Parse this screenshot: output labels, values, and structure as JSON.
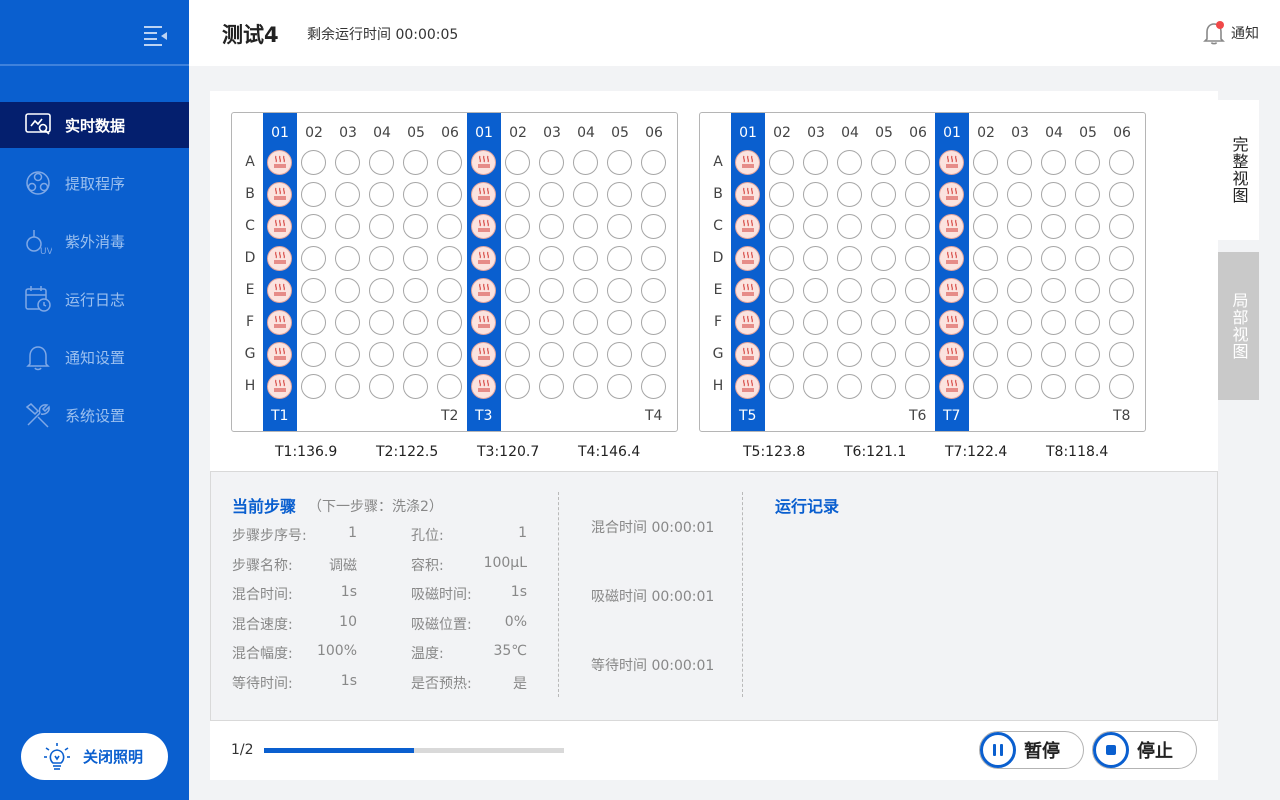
{
  "sidebar": {
    "items": [
      {
        "label": "实时数据",
        "icon": "monitor-data-icon",
        "active": true
      },
      {
        "label": "提取程序",
        "icon": "molecule-icon",
        "active": false
      },
      {
        "label": "紫外消毒",
        "icon": "uv-lamp-icon",
        "active": false
      },
      {
        "label": "运行日志",
        "icon": "calendar-clock-icon",
        "active": false
      },
      {
        "label": "通知设置",
        "icon": "bell-icon",
        "active": false
      },
      {
        "label": "系统设置",
        "icon": "tools-icon",
        "active": false
      }
    ],
    "light_button": "关闭照明"
  },
  "header": {
    "title": "测试4",
    "remaining": "剩余运行时间 00:00:05",
    "notify": "通知"
  },
  "colors": {
    "primary": "#0a5fcf",
    "active_nav": "#041f6e",
    "heated_well": "#fbe3df",
    "badge": "#f04848"
  },
  "plates": [
    {
      "columns": [
        "01",
        "02",
        "03",
        "04",
        "05",
        "06",
        "01",
        "02",
        "03",
        "04",
        "05",
        "06"
      ],
      "highlight_cols": [
        0,
        6
      ],
      "rows": [
        "A",
        "B",
        "C",
        "D",
        "E",
        "F",
        "G",
        "H"
      ],
      "labels": [
        "T1",
        "T2",
        "T3",
        "T4"
      ],
      "temps": [
        "T1:136.9",
        "T2:122.5",
        "T3:120.7",
        "T4:146.4"
      ]
    },
    {
      "columns": [
        "01",
        "02",
        "03",
        "04",
        "05",
        "06",
        "01",
        "02",
        "03",
        "04",
        "05",
        "06"
      ],
      "highlight_cols": [
        0,
        6
      ],
      "rows": [
        "A",
        "B",
        "C",
        "D",
        "E",
        "F",
        "G",
        "H"
      ],
      "labels": [
        "T5",
        "T6",
        "T7",
        "T8"
      ],
      "temps": [
        "T5:123.8",
        "T6:121.1",
        "T7:122.4",
        "T8:118.4"
      ]
    }
  ],
  "view_tabs": {
    "full": "完整视图",
    "partial": "局部视图"
  },
  "current_step": {
    "title": "当前步骤",
    "next": "（下一步骤：洗涤2）",
    "left": [
      {
        "label": "步骤步序号:",
        "value": "1"
      },
      {
        "label": "步骤名称:",
        "value": "调磁"
      },
      {
        "label": "混合时间:",
        "value": "1s"
      },
      {
        "label": "混合速度:",
        "value": "10"
      },
      {
        "label": "混合幅度:",
        "value": "100%"
      },
      {
        "label": "等待时间:",
        "value": "1s"
      }
    ],
    "right": [
      {
        "label": "孔位:",
        "value": "1"
      },
      {
        "label": "容积:",
        "value": "100μL"
      },
      {
        "label": "吸磁时间:",
        "value": "1s"
      },
      {
        "label": "吸磁位置:",
        "value": "0%"
      },
      {
        "label": "温度:",
        "value": "35℃"
      },
      {
        "label": "是否预热:",
        "value": "是"
      }
    ],
    "timers": [
      "混合时间 00:00:01",
      "吸磁时间 00:00:01",
      "等待时间 00:00:01"
    ]
  },
  "run_log": {
    "title": "运行记录"
  },
  "footer": {
    "page": "1/2",
    "progress": 0.5,
    "pause": "暂停",
    "stop": "停止"
  }
}
